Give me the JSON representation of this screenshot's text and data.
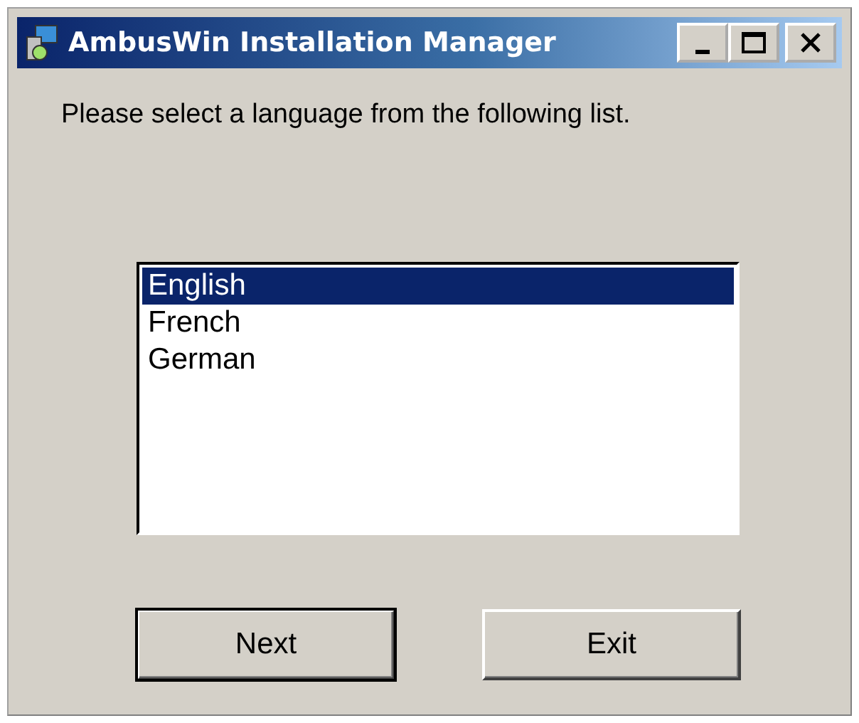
{
  "window": {
    "title": "AmbusWin Installation Manager"
  },
  "prompt": "Please select a language from the following list.",
  "languages": [
    {
      "label": "English",
      "selected": true
    },
    {
      "label": "French",
      "selected": false
    },
    {
      "label": "German",
      "selected": false
    }
  ],
  "buttons": [
    {
      "label": "Next",
      "default": true
    },
    {
      "label": "Exit",
      "default": false
    }
  ]
}
